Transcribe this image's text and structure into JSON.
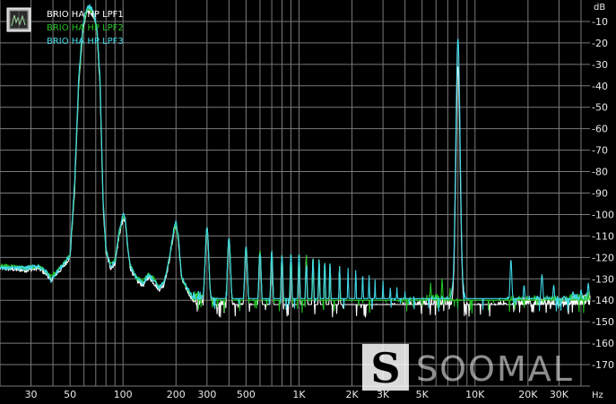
{
  "chart_data": {
    "type": "line",
    "title": "",
    "xlabel": "",
    "ylabel": "",
    "x_unit": "Hz",
    "y_unit": "dB",
    "x_scale": "log",
    "xlim": [
      20,
      45000
    ],
    "ylim": [
      -180,
      0
    ],
    "grid": true,
    "legend_position": "top-left",
    "x_ticks": [
      {
        "value": 30,
        "label": "30"
      },
      {
        "value": 50,
        "label": "50"
      },
      {
        "value": 100,
        "label": "100"
      },
      {
        "value": 200,
        "label": "200"
      },
      {
        "value": 300,
        "label": "300"
      },
      {
        "value": 500,
        "label": "500"
      },
      {
        "value": 1000,
        "label": "1K"
      },
      {
        "value": 2000,
        "label": "2K"
      },
      {
        "value": 3000,
        "label": "3K"
      },
      {
        "value": 5000,
        "label": "5K"
      },
      {
        "value": 10000,
        "label": "10K"
      },
      {
        "value": 20000,
        "label": "20K"
      },
      {
        "value": 30000,
        "label": "30K"
      }
    ],
    "y_ticks": [
      {
        "value": -10,
        "label": "-10"
      },
      {
        "value": -20,
        "label": "-20"
      },
      {
        "value": -30,
        "label": "-30"
      },
      {
        "value": -40,
        "label": "-40"
      },
      {
        "value": -50,
        "label": "-50"
      },
      {
        "value": -60,
        "label": "-60"
      },
      {
        "value": -70,
        "label": "-70"
      },
      {
        "value": -80,
        "label": "-80"
      },
      {
        "value": -90,
        "label": "-90"
      },
      {
        "value": -100,
        "label": "-100"
      },
      {
        "value": -110,
        "label": "-110"
      },
      {
        "value": -120,
        "label": "-120"
      },
      {
        "value": -130,
        "label": "-130"
      },
      {
        "value": -140,
        "label": "-140"
      },
      {
        "value": -150,
        "label": "-150"
      },
      {
        "value": -160,
        "label": "-160"
      },
      {
        "value": -170,
        "label": "-170"
      }
    ],
    "series": [
      {
        "name": "BRIO HA HP LPF1",
        "color": "#ffffff",
        "points": [
          [
            20,
            -125
          ],
          [
            28,
            -126
          ],
          [
            33,
            -125
          ],
          [
            37,
            -128
          ],
          [
            39,
            -131
          ],
          [
            40,
            -129
          ],
          [
            44,
            -126
          ],
          [
            47,
            -123
          ],
          [
            50,
            -120
          ],
          [
            53,
            -90
          ],
          [
            56,
            -40
          ],
          [
            59,
            -15
          ],
          [
            62,
            -6
          ],
          [
            65,
            -5
          ],
          [
            68,
            -8
          ],
          [
            71,
            -14
          ],
          [
            74,
            -40
          ],
          [
            77,
            -95
          ],
          [
            80,
            -118
          ],
          [
            85,
            -125
          ],
          [
            90,
            -123
          ],
          [
            95,
            -110
          ],
          [
            100,
            -102
          ],
          [
            103,
            -103
          ],
          [
            106,
            -115
          ],
          [
            110,
            -125
          ],
          [
            120,
            -131
          ],
          [
            130,
            -133
          ],
          [
            140,
            -129
          ],
          [
            150,
            -132
          ],
          [
            160,
            -135
          ],
          [
            170,
            -133
          ],
          [
            180,
            -125
          ],
          [
            195,
            -108
          ],
          [
            200,
            -105
          ],
          [
            206,
            -112
          ],
          [
            215,
            -130
          ],
          [
            230,
            -135
          ],
          [
            250,
            -140
          ],
          [
            280,
            -140
          ],
          [
            300,
            -142
          ],
          [
            350,
            -143
          ],
          [
            400,
            -144
          ],
          [
            500,
            -144
          ],
          [
            700,
            -145
          ],
          [
            1000,
            -145
          ],
          [
            1500,
            -145
          ],
          [
            2000,
            -145
          ],
          [
            3000,
            -145
          ],
          [
            4000,
            -144
          ],
          [
            5000,
            -143
          ],
          [
            6000,
            -142
          ],
          [
            7000,
            -142
          ],
          [
            8000,
            -143
          ],
          [
            10000,
            -144
          ],
          [
            13000,
            -144
          ],
          [
            15000,
            -142
          ],
          [
            20000,
            -142
          ],
          [
            30000,
            -142
          ],
          [
            40000,
            -141
          ],
          [
            45000,
            -140
          ]
        ]
      },
      {
        "name": "BRIO HA HP LPF2",
        "color": "#22c022",
        "points": [
          [
            20,
            -124
          ],
          [
            28,
            -125
          ],
          [
            33,
            -124
          ],
          [
            37,
            -127
          ],
          [
            39,
            -129
          ],
          [
            40,
            -128
          ],
          [
            44,
            -125
          ],
          [
            47,
            -122
          ],
          [
            50,
            -119
          ],
          [
            53,
            -88
          ],
          [
            56,
            -38
          ],
          [
            59,
            -14
          ],
          [
            62,
            -5
          ],
          [
            65,
            -4
          ],
          [
            68,
            -7
          ],
          [
            71,
            -13
          ],
          [
            74,
            -38
          ],
          [
            77,
            -93
          ],
          [
            80,
            -117
          ],
          [
            85,
            -123
          ],
          [
            90,
            -121
          ],
          [
            95,
            -109
          ],
          [
            100,
            -101
          ],
          [
            103,
            -102
          ],
          [
            106,
            -114
          ],
          [
            110,
            -124
          ],
          [
            120,
            -130
          ],
          [
            130,
            -131
          ],
          [
            140,
            -128
          ],
          [
            150,
            -130
          ],
          [
            160,
            -134
          ],
          [
            170,
            -132
          ],
          [
            180,
            -124
          ],
          [
            195,
            -107
          ],
          [
            200,
            -104
          ],
          [
            206,
            -111
          ],
          [
            215,
            -129
          ],
          [
            230,
            -134
          ],
          [
            250,
            -139
          ],
          [
            280,
            -139
          ],
          [
            300,
            -141
          ],
          [
            350,
            -142
          ],
          [
            400,
            -143
          ],
          [
            500,
            -143
          ],
          [
            700,
            -144
          ],
          [
            1000,
            -144
          ],
          [
            1500,
            -144
          ],
          [
            2000,
            -144
          ],
          [
            3000,
            -143
          ],
          [
            4000,
            -142
          ],
          [
            5000,
            -141
          ],
          [
            6000,
            -140
          ],
          [
            7000,
            -140
          ],
          [
            8000,
            -142
          ],
          [
            10000,
            -143
          ],
          [
            13000,
            -143
          ],
          [
            15000,
            -141
          ],
          [
            20000,
            -141
          ],
          [
            30000,
            -141
          ],
          [
            40000,
            -140
          ],
          [
            45000,
            -139
          ]
        ]
      },
      {
        "name": "BRIO HA HP LPF3",
        "color": "#40d8e8",
        "points": [
          [
            20,
            -125
          ],
          [
            28,
            -125
          ],
          [
            33,
            -124
          ],
          [
            37,
            -127
          ],
          [
            39,
            -131
          ],
          [
            40,
            -129
          ],
          [
            44,
            -125
          ],
          [
            47,
            -122
          ],
          [
            50,
            -119
          ],
          [
            53,
            -86
          ],
          [
            56,
            -36
          ],
          [
            59,
            -12
          ],
          [
            62,
            -4
          ],
          [
            65,
            -3
          ],
          [
            68,
            -6
          ],
          [
            71,
            -12
          ],
          [
            74,
            -36
          ],
          [
            77,
            -92
          ],
          [
            80,
            -116
          ],
          [
            85,
            -124
          ],
          [
            90,
            -122
          ],
          [
            95,
            -108
          ],
          [
            100,
            -100
          ],
          [
            103,
            -101
          ],
          [
            106,
            -114
          ],
          [
            110,
            -124
          ],
          [
            120,
            -130
          ],
          [
            130,
            -132
          ],
          [
            140,
            -128
          ],
          [
            150,
            -131
          ],
          [
            160,
            -134
          ],
          [
            170,
            -132
          ],
          [
            180,
            -124
          ],
          [
            195,
            -106
          ],
          [
            200,
            -103
          ],
          [
            206,
            -110
          ],
          [
            215,
            -129
          ],
          [
            230,
            -134
          ],
          [
            250,
            -139
          ],
          [
            280,
            -139
          ],
          [
            300,
            -141
          ],
          [
            350,
            -142
          ],
          [
            400,
            -143
          ],
          [
            500,
            -143
          ],
          [
            700,
            -144
          ],
          [
            1000,
            -144
          ],
          [
            1500,
            -144
          ],
          [
            2000,
            -144
          ],
          [
            3000,
            -144
          ],
          [
            4000,
            -143
          ],
          [
            5000,
            -142
          ],
          [
            6000,
            -141
          ],
          [
            7000,
            -141
          ],
          [
            8000,
            -142
          ],
          [
            10000,
            -143
          ],
          [
            13000,
            -143
          ],
          [
            15000,
            -141
          ],
          [
            20000,
            -141
          ],
          [
            30000,
            -141
          ],
          [
            40000,
            -140
          ],
          [
            45000,
            -139
          ]
        ]
      }
    ],
    "peaks": [
      {
        "x": 8000,
        "y": -18,
        "series": 2,
        "width": 0.05
      },
      {
        "x": 8000,
        "y": -31,
        "series": 0,
        "width": 0.05
      },
      {
        "x": 300,
        "y": -106,
        "series": 2,
        "width": 0.04
      },
      {
        "x": 400,
        "y": -111,
        "series": 2,
        "width": 0.035
      },
      {
        "x": 500,
        "y": -115,
        "series": 2,
        "width": 0.03
      },
      {
        "x": 600,
        "y": -117,
        "series": 2,
        "width": 0.025
      },
      {
        "x": 700,
        "y": -117,
        "series": 2,
        "width": 0.022
      },
      {
        "x": 800,
        "y": -119,
        "series": 2,
        "width": 0.02
      },
      {
        "x": 900,
        "y": -118,
        "series": 2,
        "width": 0.018
      },
      {
        "x": 1000,
        "y": -118,
        "series": 2,
        "width": 0.017
      },
      {
        "x": 1100,
        "y": -119,
        "series": 2,
        "width": 0.016
      },
      {
        "x": 1200,
        "y": -120,
        "series": 2,
        "width": 0.015
      },
      {
        "x": 1300,
        "y": -121,
        "series": 2,
        "width": 0.014
      },
      {
        "x": 1400,
        "y": -122,
        "series": 2,
        "width": 0.014
      },
      {
        "x": 1500,
        "y": -123,
        "series": 2,
        "width": 0.013
      },
      {
        "x": 1700,
        "y": -124,
        "series": 2,
        "width": 0.012
      },
      {
        "x": 1900,
        "y": -125,
        "series": 2,
        "width": 0.012
      },
      {
        "x": 2100,
        "y": -126,
        "series": 2,
        "width": 0.011
      },
      {
        "x": 2300,
        "y": -127,
        "series": 2,
        "width": 0.011
      },
      {
        "x": 2500,
        "y": -128,
        "series": 2,
        "width": 0.01
      },
      {
        "x": 2700,
        "y": -130,
        "series": 2,
        "width": 0.01
      },
      {
        "x": 3000,
        "y": -131,
        "series": 2,
        "width": 0.01
      },
      {
        "x": 3300,
        "y": -133,
        "series": 2,
        "width": 0.01
      },
      {
        "x": 3600,
        "y": -134,
        "series": 2,
        "width": 0.01
      },
      {
        "x": 4000,
        "y": -136,
        "series": 2,
        "width": 0.01
      },
      {
        "x": 4500,
        "y": -138,
        "series": 2,
        "width": 0.01
      },
      {
        "x": 5600,
        "y": -132,
        "series": 1,
        "width": 0.012
      },
      {
        "x": 6500,
        "y": -130,
        "series": 1,
        "width": 0.012
      },
      {
        "x": 7200,
        "y": -134,
        "series": 1,
        "width": 0.01
      },
      {
        "x": 8000,
        "y": -112,
        "series": 2,
        "width": 0.08
      },
      {
        "x": 8400,
        "y": -124,
        "series": 2,
        "width": 0.02
      },
      {
        "x": 12500,
        "y": -140,
        "series": 2,
        "width": 0.01
      },
      {
        "x": 16000,
        "y": -121,
        "series": 2,
        "width": 0.02
      },
      {
        "x": 19000,
        "y": -133,
        "series": 2,
        "width": 0.015
      },
      {
        "x": 24000,
        "y": -128,
        "series": 2,
        "width": 0.02
      },
      {
        "x": 28000,
        "y": -133,
        "series": 2,
        "width": 0.015
      },
      {
        "x": 32000,
        "y": -138,
        "series": 2,
        "width": 0.015
      },
      {
        "x": 36000,
        "y": -136,
        "series": 2,
        "width": 0.015
      },
      {
        "x": 40000,
        "y": -135,
        "series": 2,
        "width": 0.015
      },
      {
        "x": 44000,
        "y": -132,
        "series": 2,
        "width": 0.015
      }
    ]
  },
  "watermark": {
    "text": "SOOMAL",
    "logo": "S",
    "logo_icon": "soomal-logo-icon"
  },
  "legend_icon": "trace-window-icon",
  "colors": {
    "background": "#000000",
    "grid": "#7a7a7a",
    "axis_text": "#e8e8e8"
  }
}
